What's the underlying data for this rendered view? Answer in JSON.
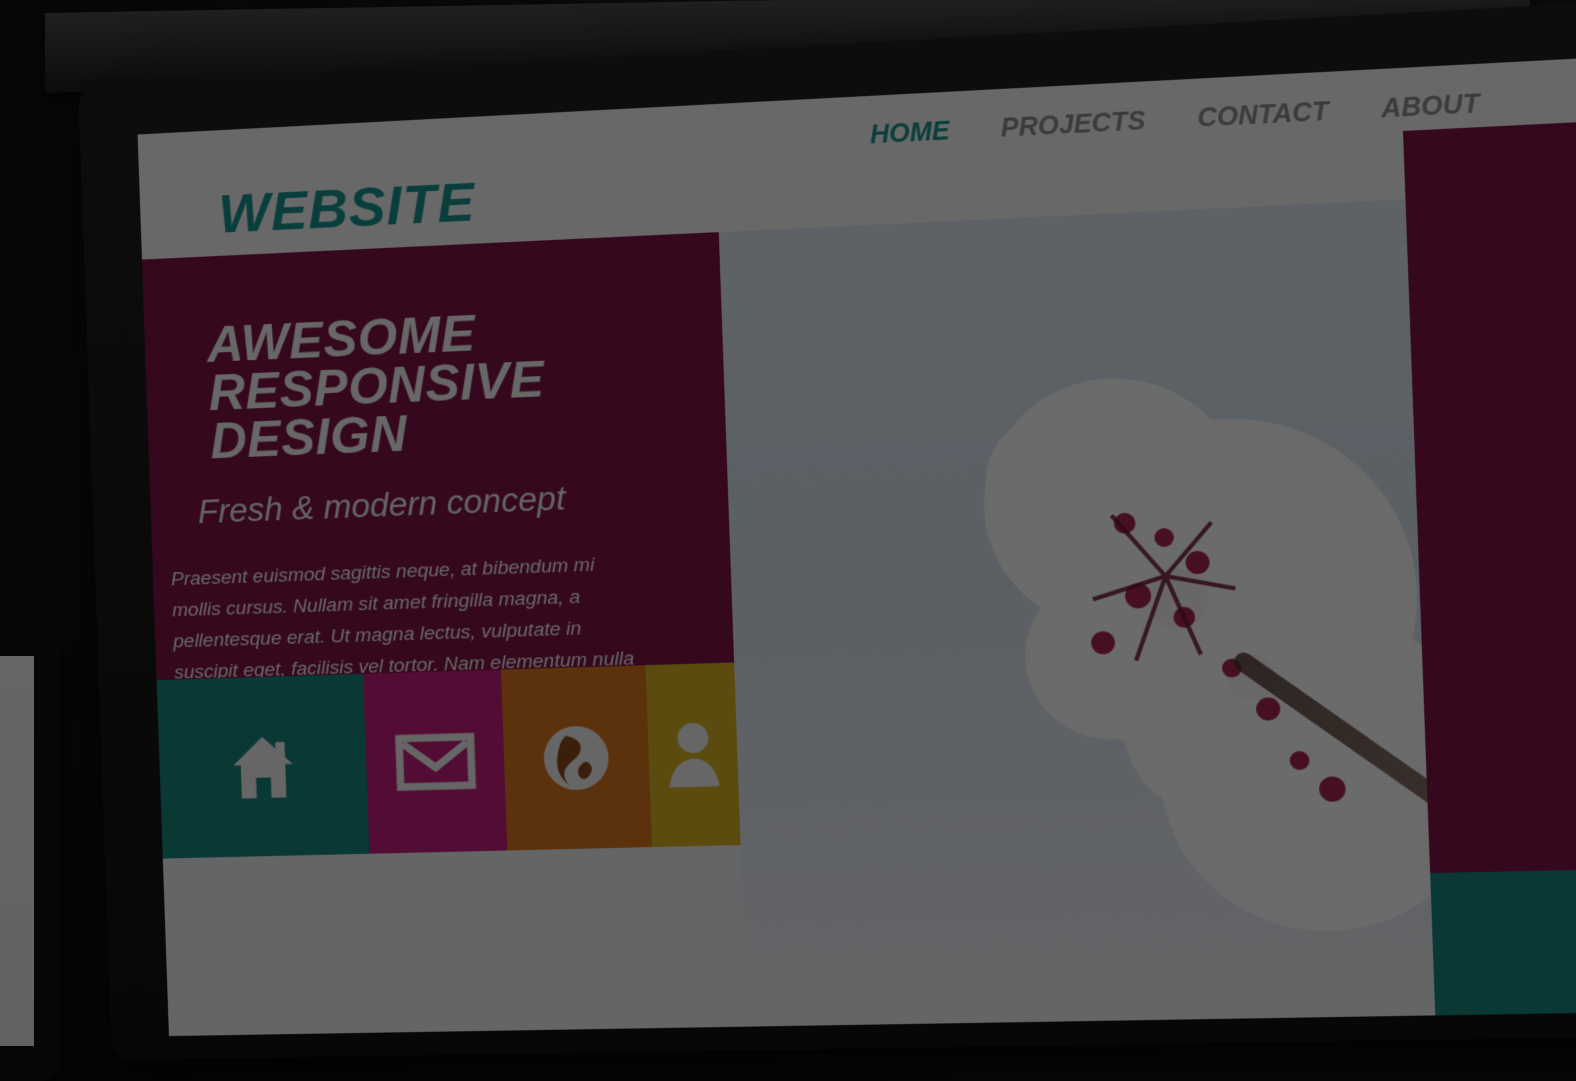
{
  "site": {
    "brand": "WEBSITE",
    "nav": [
      {
        "label": "HOME"
      },
      {
        "label": "PROJECTS"
      },
      {
        "label": "CONTACT"
      },
      {
        "label": "ABOUT"
      }
    ],
    "headline_lines": [
      "AWESOME",
      "RESPONSIVE",
      "DESIGN"
    ],
    "subtitle": "Fresh & modern concept",
    "body": "Praesent euismod sagittis neque, at bibendum mi mollis cursus. Nullam sit amet fringilla magna, a pellentesque erat. Ut magna lectus, vulputate in suscipit eget, facilisis vel tortor. Nam elementum nulla id vulputate fermentum. Vestibulum tellus quam, ullamcorper eget aliquet."
  },
  "colors": {
    "brand": "#16958f",
    "magenta": "#7f1345",
    "teal": "#17877f",
    "pink": "#c61d7a",
    "orange": "#d8781e",
    "yellow": "#d8b322",
    "light_bg": "#f7f7f7"
  },
  "icons": {
    "home": "home-icon",
    "mail": "mail-icon",
    "globe": "globe-icon",
    "user": "user-icon"
  }
}
